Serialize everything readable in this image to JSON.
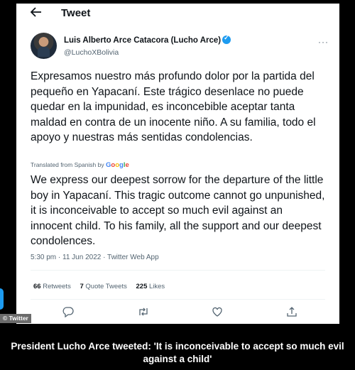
{
  "header": {
    "back_icon": "arrow-left-icon",
    "title": "Tweet"
  },
  "author": {
    "name": "Luis Alberto Arce Catacora (Lucho Arce)",
    "handle": "@LuchoXBolivia",
    "verified": true,
    "verified_color": "#1d9bf0",
    "more_icon": "more-dots-icon",
    "more_label": "···"
  },
  "tweet": {
    "text_es": "Expresamos nuestro más profundo dolor por la partida del pequeño en Yapacaní. Este trágico desenlace no puede quedar en la impunidad, es inconcebible aceptar tanta maldad en contra de un inocente niño. A su familia, todo el apoyo y nuestras más sentidas condolencias.",
    "translated_label": "Translated from Spanish by",
    "translator": [
      "G",
      "o",
      "o",
      "g",
      "l",
      "e"
    ],
    "text_en": "We express our deepest sorrow for the departure of the little boy in Yapacaní. This tragic outcome cannot go unpunished, it is inconceivable to accept so much evil against an innocent child. To his family, all the support and our deepest condolences.",
    "meta": "5:30 pm · 11 Jun 2022 · Twitter Web App"
  },
  "stats": {
    "retweets_count": "66",
    "retweets_label": "Retweets",
    "quotes_count": "7",
    "quotes_label": "Quote Tweets",
    "likes_count": "225",
    "likes_label": "Likes"
  },
  "actions": [
    "reply-icon",
    "retweet-icon",
    "like-icon",
    "share-icon"
  ],
  "overlay": {
    "credit": "© Twitter",
    "accent": "#1d9bf0"
  },
  "caption": "President Lucho Arce tweeted: 'It is inconceivable to accept so much evil against a child'"
}
